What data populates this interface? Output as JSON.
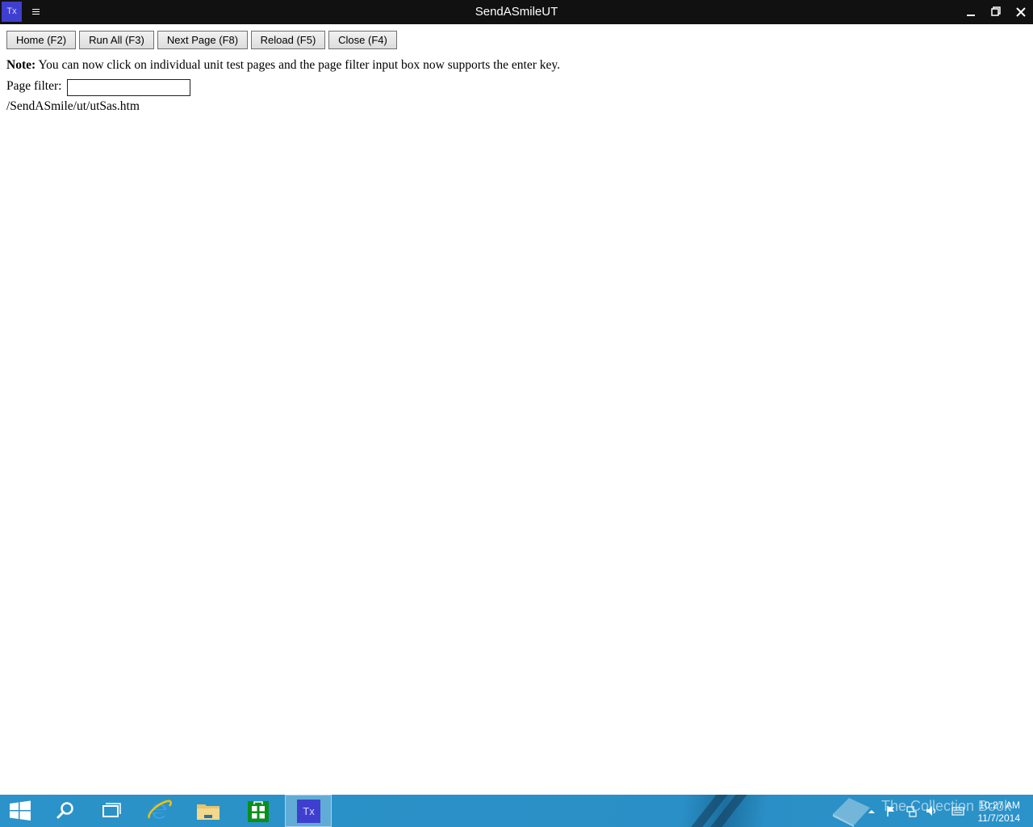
{
  "window": {
    "app_icon_label": "Tx",
    "title": "SendASmileUT"
  },
  "toolbar": {
    "home_label": "Home (F2)",
    "run_all_label": "Run All (F3)",
    "next_page_label": "Next Page (F8)",
    "reload_label": "Reload (F5)",
    "close_label": "Close (F4)"
  },
  "note": {
    "prefix": "Note:",
    "text": " You can now click on individual unit test pages and the page filter input box now supports the enter key."
  },
  "filter": {
    "label": "Page filter:",
    "value": ""
  },
  "pages": [
    "/SendASmile/ut/utSas.htm"
  ],
  "taskbar": {
    "active_app_label": "Tx",
    "watermark": "The Collection Book",
    "clock_time": "10:27 AM",
    "clock_date": "11/7/2014",
    "accent": "#2b93c9"
  },
  "icons": [
    "windows-start-icon",
    "search-icon",
    "task-view-icon",
    "internet-explorer-icon",
    "file-explorer-icon",
    "store-icon",
    "tx-app-icon",
    "menu-icon",
    "minimize-icon",
    "restore-icon",
    "close-icon",
    "show-hidden-icons-icon",
    "action-center-flag-icon",
    "network-icon",
    "volume-icon",
    "keyboard-icon"
  ]
}
